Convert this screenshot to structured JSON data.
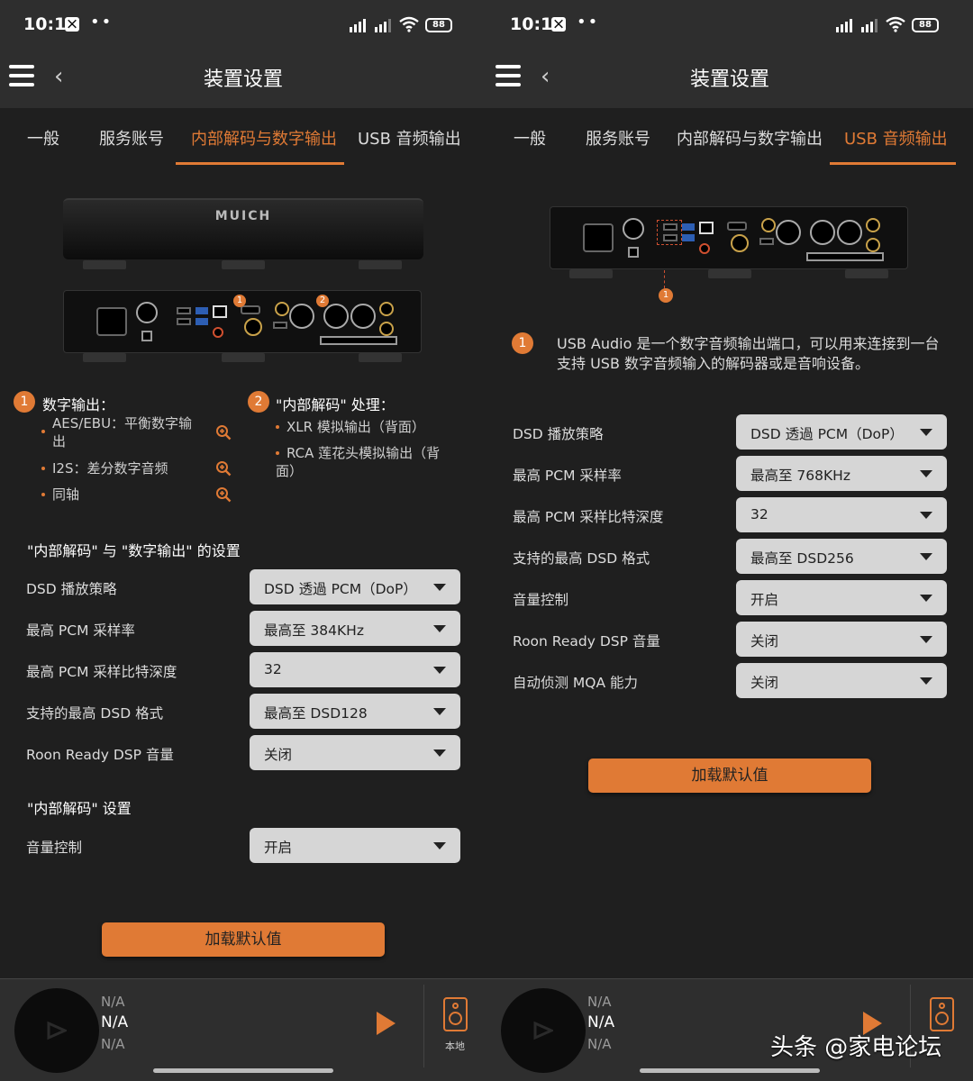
{
  "status_bar": {
    "time": "10:17",
    "app_glyph": "⨉",
    "dots": "••",
    "signal_label": "HD",
    "battery": "88"
  },
  "header": {
    "title": "装置设置",
    "menu_icon": "hamburger-menu-icon",
    "back_icon": "chevron-left-icon",
    "back_glyph": "‹"
  },
  "tabs": [
    "一般",
    "服务账号",
    "内部解码与数字输出",
    "USB 音频输出"
  ],
  "device": {
    "logo": "MUICH",
    "markers": [
      "1",
      "2"
    ]
  },
  "left": {
    "active_tab": 2,
    "legend": {
      "digital": {
        "marker": "1",
        "title": "数字输出：",
        "items": [
          "AES/EBU：平衡数字输出",
          "I2S：差分数字音频",
          "同轴"
        ]
      },
      "decode": {
        "marker": "2",
        "title": "\"内部解码\" 处理：",
        "items": [
          "XLR 模拟输出（背面）",
          "RCA 莲花头模拟输出（背面）"
        ]
      }
    },
    "section1_title": "\"内部解码\" 与 \"数字输出\" 的设置",
    "section1_rows": [
      {
        "label": "DSD 播放策略",
        "value": "DSD 透過 PCM（DoP）"
      },
      {
        "label": "最高 PCM 采样率",
        "value": "最高至 384KHz"
      },
      {
        "label": "最高 PCM 采样比特深度",
        "value": "32"
      },
      {
        "label": "支持的最高 DSD 格式",
        "value": "最高至 DSD128"
      },
      {
        "label": "Roon Ready DSP 音量",
        "value": "关闭"
      }
    ],
    "section2_title": "\"内部解码\" 设置",
    "section2_rows": [
      {
        "label": "音量控制",
        "value": "开启"
      }
    ],
    "default_button": "加载默认值"
  },
  "right": {
    "active_tab": 3,
    "marker": "1",
    "description": "USB Audio 是一个数字音频输出端口，可以用来连接到一台支持 USB 数字音频输入的解码器或是音响设备。",
    "rows": [
      {
        "label": "DSD 播放策略",
        "value": "DSD 透過 PCM（DoP）"
      },
      {
        "label": "最高 PCM 采样率",
        "value": "最高至 768KHz"
      },
      {
        "label": "最高 PCM 采样比特深度",
        "value": "32"
      },
      {
        "label": "支持的最高 DSD 格式",
        "value": "最高至 DSD256"
      },
      {
        "label": "音量控制",
        "value": "开启"
      },
      {
        "label": "Roon Ready DSP 音量",
        "value": "关闭"
      },
      {
        "label": "自动侦测 MQA 能力",
        "value": "关闭"
      }
    ],
    "default_button": "加载默认值"
  },
  "player": {
    "line1": "N/A",
    "line2": "N/A",
    "line3": "N/A",
    "play_icon": "play-icon",
    "speaker_icon": "speaker-icon",
    "speaker_label": "本地"
  },
  "colors": {
    "accent": "#e07a35",
    "background": "#1f1f1f",
    "bar": "#2e2e2e",
    "select": "#d6d6d6"
  },
  "watermark": "头条 @家电论坛"
}
